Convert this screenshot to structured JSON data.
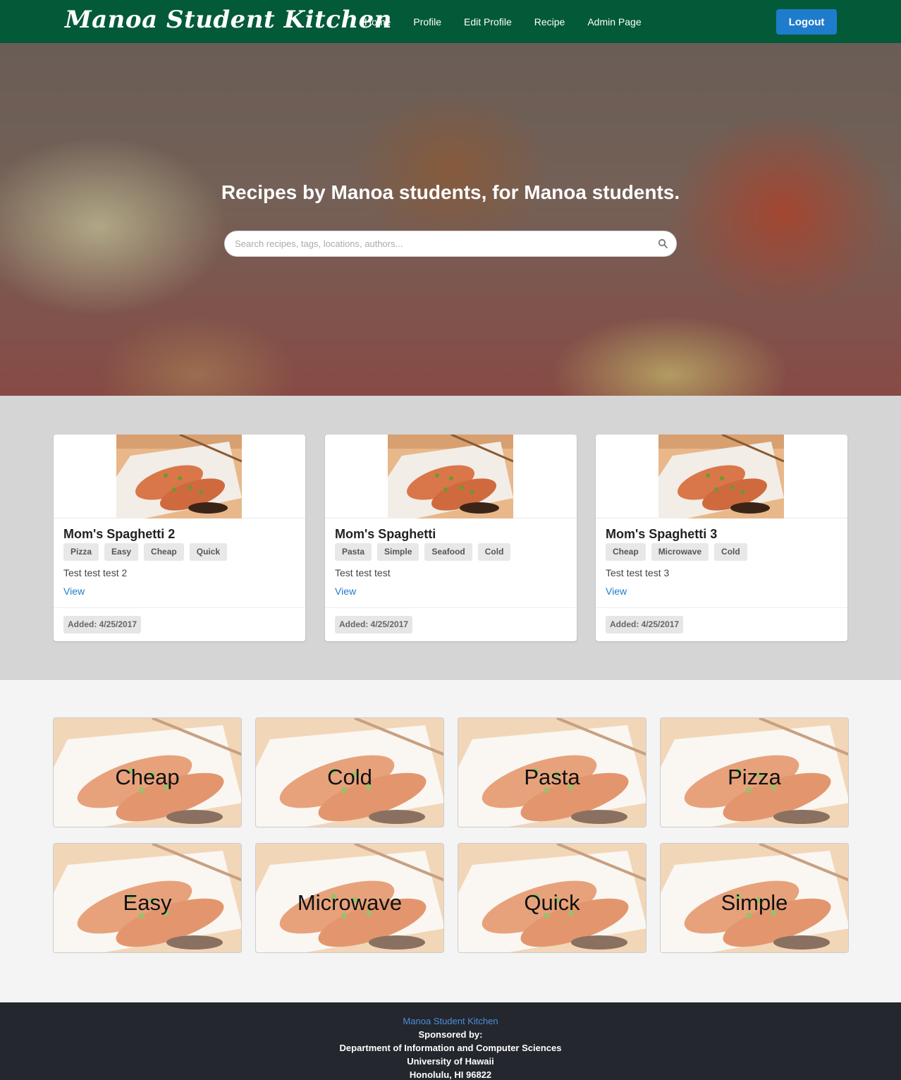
{
  "navbar": {
    "brand": "Manoa Student Kitchen",
    "links": [
      "Home",
      "Profile",
      "Edit Profile",
      "Recipe",
      "Admin Page"
    ],
    "logout_label": "Logout"
  },
  "hero": {
    "title": "Recipes by Manoa students, for Manoa students.",
    "search_placeholder": "Search recipes, tags, locations, authors..."
  },
  "recipes": [
    {
      "title": "Mom's Spaghetti 2",
      "tags": [
        "Pizza",
        "Easy",
        "Cheap",
        "Quick"
      ],
      "description": "Test test test 2",
      "link": "View",
      "added": "Added: 4/25/2017"
    },
    {
      "title": "Mom's Spaghetti",
      "tags": [
        "Pasta",
        "Simple",
        "Seafood",
        "Cold"
      ],
      "description": "Test test test",
      "link": "View",
      "added": "Added: 4/25/2017"
    },
    {
      "title": "Mom's Spaghetti 3",
      "tags": [
        "Cheap",
        "Microwave",
        "Cold"
      ],
      "description": "Test test test 3",
      "link": "View",
      "added": "Added: 4/25/2017"
    }
  ],
  "categories": [
    "Cheap",
    "Cold",
    "Pasta",
    "Pizza",
    "Easy",
    "Microwave",
    "Quick",
    "Simple"
  ],
  "footer": {
    "brand": "Manoa Student Kitchen",
    "sponsored": "Sponsored by:",
    "department": "Department of Information and Computer Sciences",
    "university": "University of Hawaii",
    "address": "Honolulu, HI 96822"
  },
  "colors": {
    "navbar": "#035a38",
    "accent": "#1f7ccc",
    "footer": "#24272e"
  }
}
